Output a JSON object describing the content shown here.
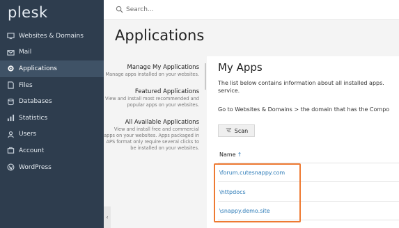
{
  "brand": {
    "logo": "plesk"
  },
  "sidebar": {
    "items": [
      {
        "label": "Websites & Domains",
        "icon": "globe-icon",
        "active": false
      },
      {
        "label": "Mail",
        "icon": "mail-icon",
        "active": false
      },
      {
        "label": "Applications",
        "icon": "gear-icon",
        "active": true
      },
      {
        "label": "Files",
        "icon": "file-icon",
        "active": false
      },
      {
        "label": "Databases",
        "icon": "database-icon",
        "active": false
      },
      {
        "label": "Statistics",
        "icon": "statistics-icon",
        "active": false
      },
      {
        "label": "Users",
        "icon": "user-icon",
        "active": false
      },
      {
        "label": "Account",
        "icon": "account-icon",
        "active": false
      },
      {
        "label": "WordPress",
        "icon": "wordpress-icon",
        "active": false
      }
    ]
  },
  "search": {
    "placeholder": "Search..."
  },
  "page": {
    "title": "Applications"
  },
  "subnav": [
    {
      "title": "Manage My Applications",
      "desc": "Manage apps installed on your websites."
    },
    {
      "title": "Featured Applications",
      "desc": "View and install most recommended and popular apps on your websites."
    },
    {
      "title": "All Available Applications",
      "desc": "View and install free and commercial apps on your websites. Apps packaged in APS format only require several clicks to be installed on your websites."
    }
  ],
  "content": {
    "title": "My Apps",
    "description": "The list below contains information about all installed apps. service.",
    "description2": "Go to Websites & Domains > the domain that has the Compo",
    "scan_label": "Scan",
    "column_name": "Name",
    "sort_indicator": "↑",
    "rows": [
      "\\forum.cutesnappy.com",
      "\\httpdocs",
      "\\snappy.demo.site"
    ]
  },
  "collapse": {
    "label": "‹"
  },
  "colors": {
    "sidebar": "#2e3d4e",
    "active": "#3f5266",
    "link": "#2b7ab7",
    "highlight": "#ee7a32"
  }
}
